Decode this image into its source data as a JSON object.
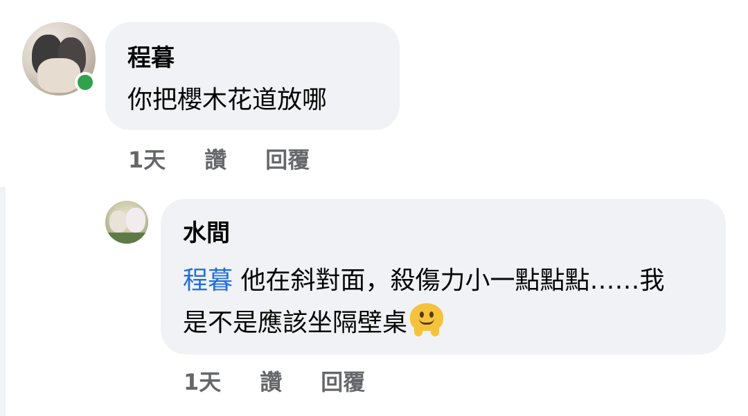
{
  "comments": [
    {
      "author": "程暮",
      "text": "你把櫻木花道放哪",
      "time": "1天",
      "like_label": "讚",
      "reply_label": "回覆",
      "online": true
    },
    {
      "author": "水間",
      "mention": "程暮",
      "text": "他在斜對面，殺傷力小一點點點……我是不是應該坐隔壁桌",
      "emoji": "melting-face",
      "time": "1天",
      "like_label": "讚",
      "reply_label": "回覆"
    }
  ],
  "colors": {
    "bubble_bg": "#f0f2f5",
    "mention": "#216fdb",
    "meta_text": "#65676b",
    "online_dot": "#31a24c"
  }
}
